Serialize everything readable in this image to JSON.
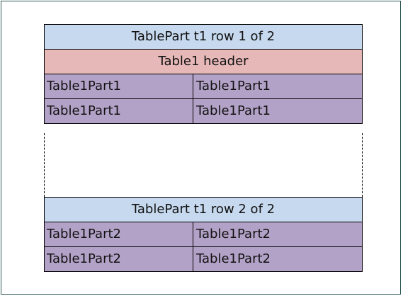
{
  "colors": {
    "part_title_fill": "#c6d9ee",
    "header_fill": "#e6b8b7",
    "cell_fill": "#b3a2c7",
    "frame_border": "#2f5a55"
  },
  "part1": {
    "title": "TablePart t1 row 1 of 2",
    "header": "Table1 header",
    "rows": [
      [
        "Table1Part1",
        "Table1Part1"
      ],
      [
        "Table1Part1",
        "Table1Part1"
      ]
    ]
  },
  "part2": {
    "title": "TablePart t1 row 2 of 2",
    "rows": [
      [
        "Table1Part2",
        "Table1Part2"
      ],
      [
        "Table1Part2",
        "Table1Part2"
      ]
    ]
  }
}
